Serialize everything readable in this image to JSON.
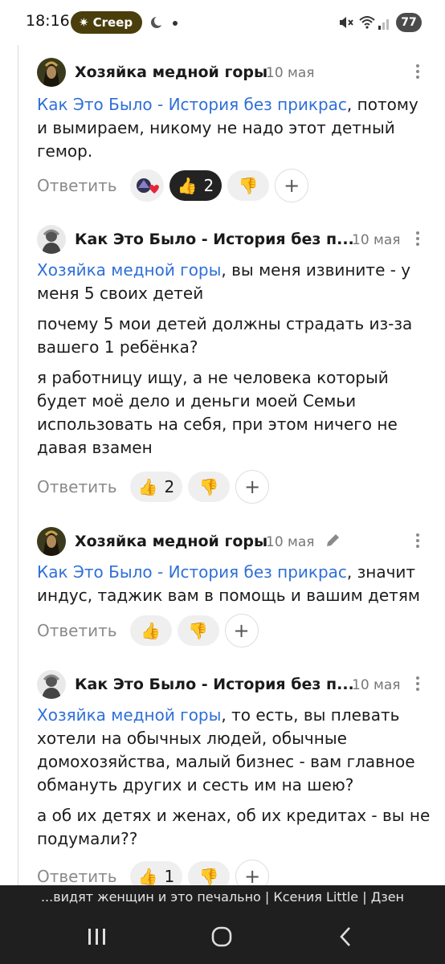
{
  "status_bar": {
    "time": "18:16",
    "pill_label": "Creep",
    "battery": "77"
  },
  "comments": [
    {
      "author": "Хозяйка медной горы",
      "date": "10 мая",
      "mention": "Как Это Было - История без прикрас",
      "paragraphs": [
        ", потому и вымираем, никому не надо этот детный гемор."
      ],
      "reply_label": "Ответить",
      "reactions": {
        "like_count": "2"
      }
    },
    {
      "author": "Как Это Было - История без п...",
      "date": "10 мая",
      "mention": "Хозяйка медной горы",
      "paragraphs": [
        ", вы меня извините - у меня 5 своих детей",
        "почему 5 мои детей должны страдать из-за вашего 1 ребёнка?",
        "я работницу ищу, а не человека который будет моё дело и деньги моей Семьи использовать на себя, при этом ничего не давая взамен"
      ],
      "reply_label": "Ответить",
      "reactions": {
        "like_count": "2"
      }
    },
    {
      "author": "Хозяйка медной горы",
      "date": "10 мая",
      "mention": "Как Это Было - История без прикрас",
      "paragraphs": [
        ", значит индус, таджик вам в помощь и вашим детям"
      ],
      "reply_label": "Ответить",
      "reactions": {}
    },
    {
      "author": "Как Это Было - История без п...",
      "date": "10 мая",
      "mention": "Хозяйка медной горы",
      "paragraphs": [
        ", то есть, вы плевать хотели на обычных людей, обычные домохозяйства, малый бизнес - вам главное обмануть других и сесть им на шею?",
        "а об их детях и женах, об их кредитах - вы не подумали??"
      ],
      "reply_label": "Ответить",
      "reactions": {
        "like_count": "1"
      }
    }
  ],
  "caption": "...видят женщин и это печально | Ксения Little | Дзен",
  "icons": {
    "reaction_heart": "avatar-heart-reaction-icon",
    "like": "thumbs-up-icon",
    "dislike": "thumbs-down-icon",
    "add": "plus-icon",
    "more": "more-vertical-icon",
    "edit": "pencil-icon"
  },
  "colors": {
    "mention": "#2f6fd8",
    "chip_bg": "#efefef",
    "chip_active_bg": "#232323",
    "reply_text": "#8a8a8a",
    "navbar_bg": "#1f1f1f"
  }
}
